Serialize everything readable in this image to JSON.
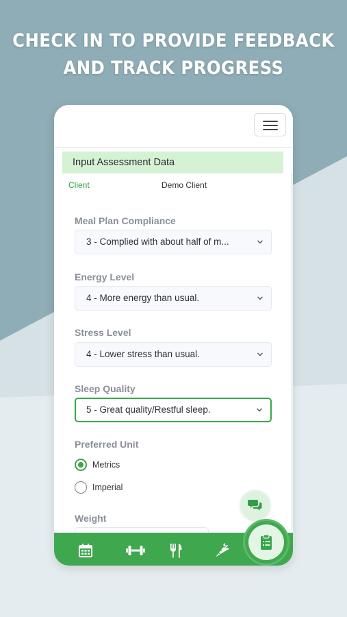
{
  "colors": {
    "background_light": "#e4ecef",
    "background_teal": "#8fadb6",
    "brand_green": "#3fa84f",
    "header_green_tint": "#d6f2d5"
  },
  "headline": {
    "line1": "CHECK IN TO PROVIDE FEEDBACK",
    "line2": "AND TRACK PROGRESS"
  },
  "topbar": {
    "menu_icon": "hamburger-menu-icon"
  },
  "form": {
    "section_title": "Input Assessment Data",
    "client_label": "Client",
    "client_value": "Demo Client",
    "fields": [
      {
        "label": "Meal Plan Compliance",
        "value": "3 - Complied with about half of m..."
      },
      {
        "label": "Energy Level",
        "value": "4 - More energy than usual."
      },
      {
        "label": "Stress Level",
        "value": "4 - Lower stress than usual."
      },
      {
        "label": "Sleep Quality",
        "value": "5 - Great quality/Restful sleep."
      }
    ],
    "preferred_unit": {
      "label": "Preferred Unit",
      "options": [
        {
          "label": "Metrics",
          "selected": true
        },
        {
          "label": "Imperial",
          "selected": false
        }
      ]
    },
    "weight_label": "Weight"
  },
  "fabs": {
    "chat_icon": "chat-bubbles-icon",
    "checkin_icon": "clipboard-icon"
  },
  "bottom_nav": [
    {
      "icon": "calendar-icon"
    },
    {
      "icon": "dumbbell-icon"
    },
    {
      "icon": "fork-knife-icon"
    },
    {
      "icon": "carrot-icon"
    }
  ]
}
